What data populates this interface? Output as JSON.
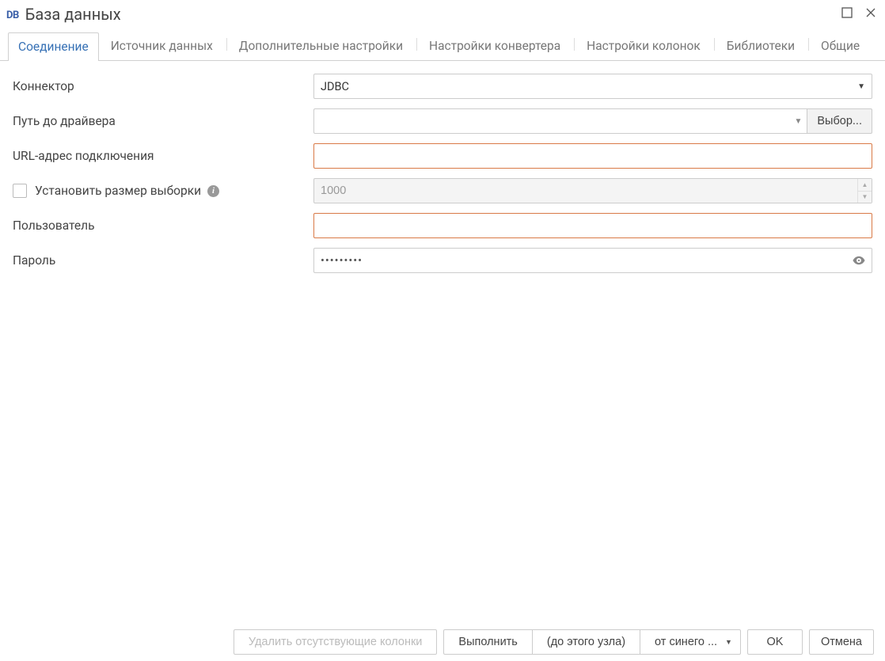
{
  "header": {
    "icon_text": "DB",
    "title": "База данных"
  },
  "tabs": [
    {
      "label": "Соединение",
      "active": true
    },
    {
      "label": "Источник данных"
    },
    {
      "label": "Дополнительные настройки"
    },
    {
      "label": "Настройки конвертера"
    },
    {
      "label": "Настройки колонок"
    },
    {
      "label": "Библиотеки"
    },
    {
      "label": "Общие"
    }
  ],
  "form": {
    "connector": {
      "label": "Коннектор",
      "value": "JDBC"
    },
    "driver_path": {
      "label": "Путь до драйвера",
      "value": "",
      "browse": "Выбор..."
    },
    "connection_url": {
      "label": "URL-адрес подключения",
      "value": ""
    },
    "fetch_size": {
      "label": "Установить размер выборки",
      "value": "1000",
      "checked": false
    },
    "user": {
      "label": "Пользователь",
      "value": ""
    },
    "password": {
      "label": "Пароль",
      "value": "•••••••••"
    }
  },
  "footer": {
    "delete_missing": "Удалить отсутствующие колонки",
    "execute": "Выполнить",
    "to_node": "(до этого узла)",
    "from_blue": "от синего ...",
    "ok": "OK",
    "cancel": "Отмена"
  }
}
